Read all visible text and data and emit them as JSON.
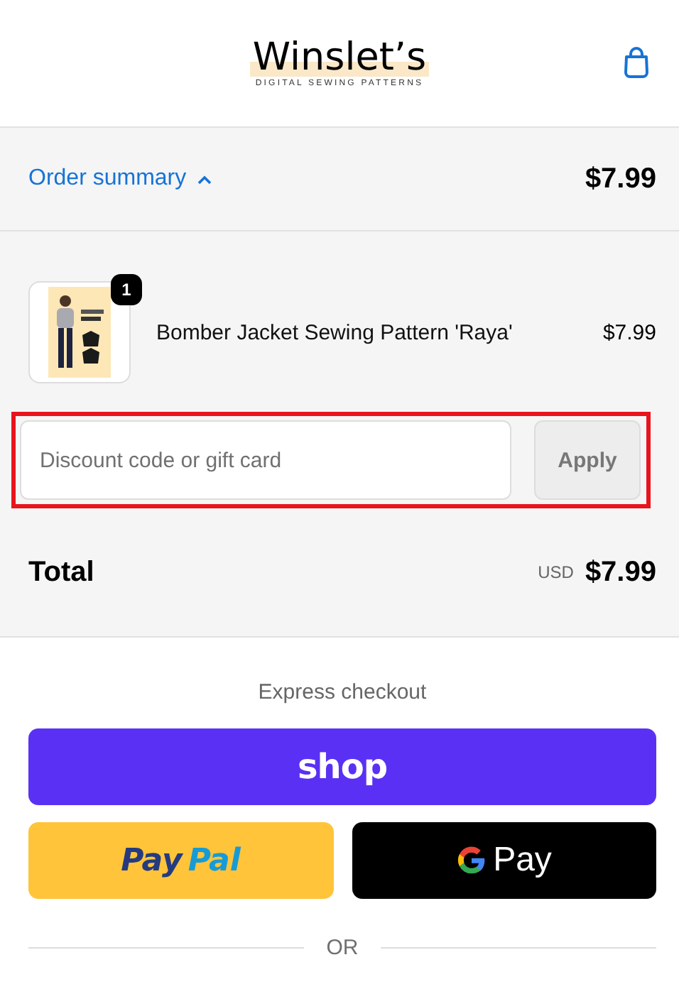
{
  "header": {
    "logo_title": "Winslet’s",
    "logo_subtitle": "DIGITAL SEWING PATTERNS"
  },
  "summary_toggle": {
    "label": "Order summary",
    "expanded": true,
    "total": "$7.99"
  },
  "line_items": [
    {
      "quantity": "1",
      "title": "Bomber Jacket Sewing Pattern 'Raya'",
      "price": "$7.99"
    }
  ],
  "discount": {
    "placeholder": "Discount code or gift card",
    "button": "Apply",
    "disabled": true,
    "highlighted": true
  },
  "total": {
    "label": "Total",
    "currency": "USD",
    "amount": "$7.99"
  },
  "express": {
    "heading": "Express checkout",
    "buttons": [
      {
        "kind": "shop",
        "label": "shop"
      },
      {
        "kind": "paypal",
        "parts": [
          "Pay",
          "Pal"
        ]
      },
      {
        "kind": "gpay",
        "label": "Pay"
      }
    ],
    "divider": "OR"
  }
}
